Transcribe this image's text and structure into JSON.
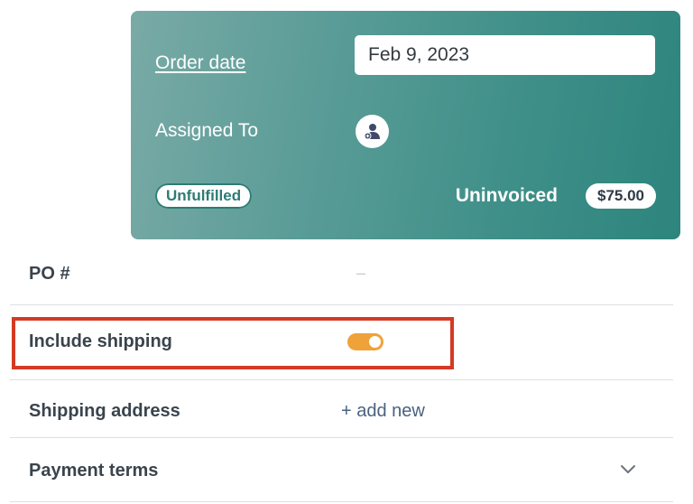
{
  "order_card": {
    "order_date_label": "Order date",
    "order_date_value": "Feb 9, 2023",
    "assigned_to_label": "Assigned To",
    "assign_icon": "assign-user-icon",
    "status_badge": "Unfulfilled",
    "invoice_status": "Uninvoiced",
    "amount": "$75.00",
    "gradient_colors": [
      "#79aaa6",
      "#2d857d"
    ]
  },
  "fields": {
    "po": {
      "label": "PO #",
      "value": "–"
    },
    "include_shipping": {
      "label": "Include shipping",
      "toggle_on": true,
      "toggle_color": "#efa23a"
    },
    "shipping_address": {
      "label": "Shipping address",
      "link": "+ add new"
    },
    "payment_terms": {
      "label": "Payment terms",
      "icon": "chevron-down-icon"
    }
  },
  "highlight_color": "#d43a25"
}
